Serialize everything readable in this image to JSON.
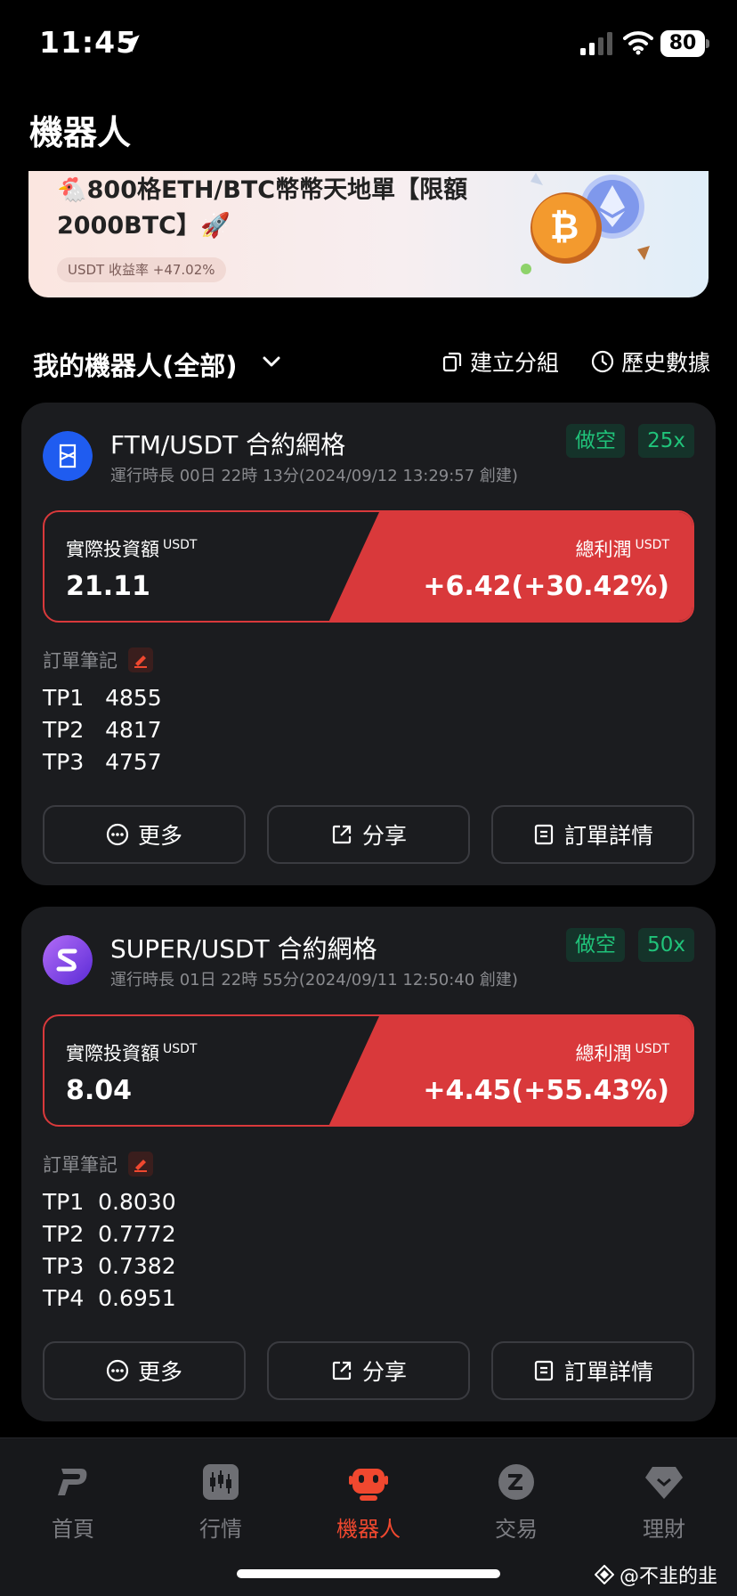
{
  "status_bar": {
    "time": "11:45",
    "battery": "80"
  },
  "page_title": "機器人",
  "banner": {
    "text": "🐔800格ETH/BTC幣幣天地單【限額2000BTC】🚀",
    "chip": "USDT 收益率 +47.02%"
  },
  "section": {
    "title": "我的機器人(全部)",
    "group_label": "建立分組",
    "history_label": "歷史數據"
  },
  "bots": [
    {
      "name": "FTM/USDT 合約網格",
      "meta": "運行時長 00日 22時 13分(2024/09/12 13:29:57 創建)",
      "side": "做空",
      "leverage": "25x",
      "investment_label": "實際投資額",
      "investment_unit": "USDT",
      "investment": "21.11",
      "profit_label": "總利潤",
      "profit_unit": "USDT",
      "profit": "+6.42(+30.42%)",
      "notes_label": "訂單筆記",
      "notes": [
        "TP1   4855",
        "TP2   4817",
        "TP3   4757"
      ],
      "more": "更多",
      "share": "分享",
      "details": "訂單詳情",
      "coin_color": "#1f5cf0"
    },
    {
      "name": "SUPER/USDT 合約網格",
      "meta": "運行時長 01日 22時 55分(2024/09/11 12:50:40 創建)",
      "side": "做空",
      "leverage": "50x",
      "investment_label": "實際投資額",
      "investment_unit": "USDT",
      "investment": "8.04",
      "profit_label": "總利潤",
      "profit_unit": "USDT",
      "profit": "+4.45(+55.43%)",
      "notes_label": "訂單筆記",
      "notes": [
        "TP1  0.8030",
        "TP2  0.7772",
        "TP3  0.7382",
        "TP4  0.6951"
      ],
      "more": "更多",
      "share": "分享",
      "details": "訂單詳情",
      "coin_color": "#7b3fe4"
    }
  ],
  "tabs": [
    {
      "label": "首頁",
      "icon": "home-icon",
      "active": false
    },
    {
      "label": "行情",
      "icon": "market-icon",
      "active": false
    },
    {
      "label": "機器人",
      "icon": "robot-icon",
      "active": true
    },
    {
      "label": "交易",
      "icon": "trade-icon",
      "active": false
    },
    {
      "label": "理財",
      "icon": "earn-icon",
      "active": false
    }
  ],
  "watermark": "@不韭的韭",
  "colors": {
    "accent": "#f0482f",
    "profit_red": "#d9393b",
    "short_green": "#20c37a"
  }
}
